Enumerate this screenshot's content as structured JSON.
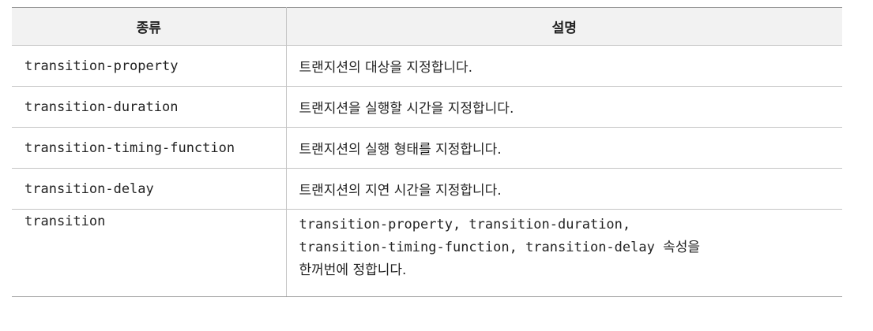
{
  "table": {
    "headers": [
      "종류",
      "설명"
    ],
    "rows": [
      {
        "property": "transition-property",
        "description": "트랜지션의 대상을 지정합니다."
      },
      {
        "property": "transition-duration",
        "description": "트랜지션을 실행할 시간을 지정합니다."
      },
      {
        "property": "transition-timing-function",
        "description": "트랜지션의 실행 형태를 지정합니다."
      },
      {
        "property": "transition-delay",
        "description": "트랜지션의 지연 시간을 지정합니다."
      },
      {
        "property": "transition",
        "description_lines": [
          "transition-property, transition-duration,",
          "transition-timing-function, transition-delay 속성을",
          "한꺼번에 정합니다."
        ]
      }
    ]
  }
}
